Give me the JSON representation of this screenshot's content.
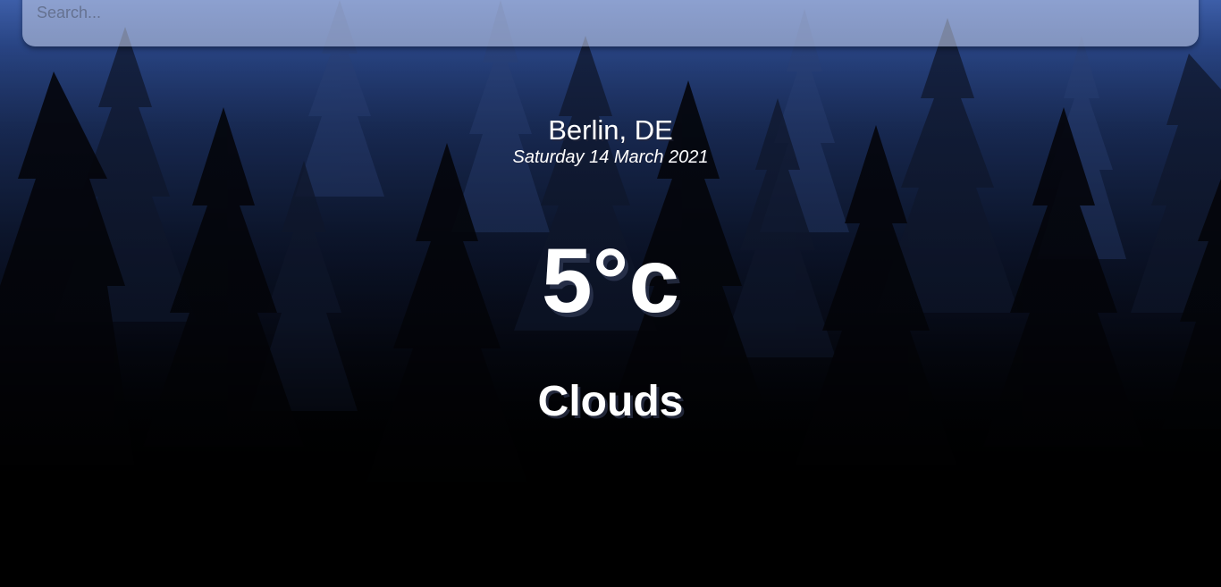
{
  "search": {
    "placeholder": "Search...",
    "value": ""
  },
  "location": {
    "name": "Berlin, DE",
    "date": "Saturday 14 March 2021"
  },
  "weather": {
    "temperature": "5°c",
    "condition": "Clouds"
  },
  "colors": {
    "sky_top": "#3d5ea8",
    "sky_mid": "#101c3a",
    "ground": "#000000",
    "text": "#ffffff"
  }
}
